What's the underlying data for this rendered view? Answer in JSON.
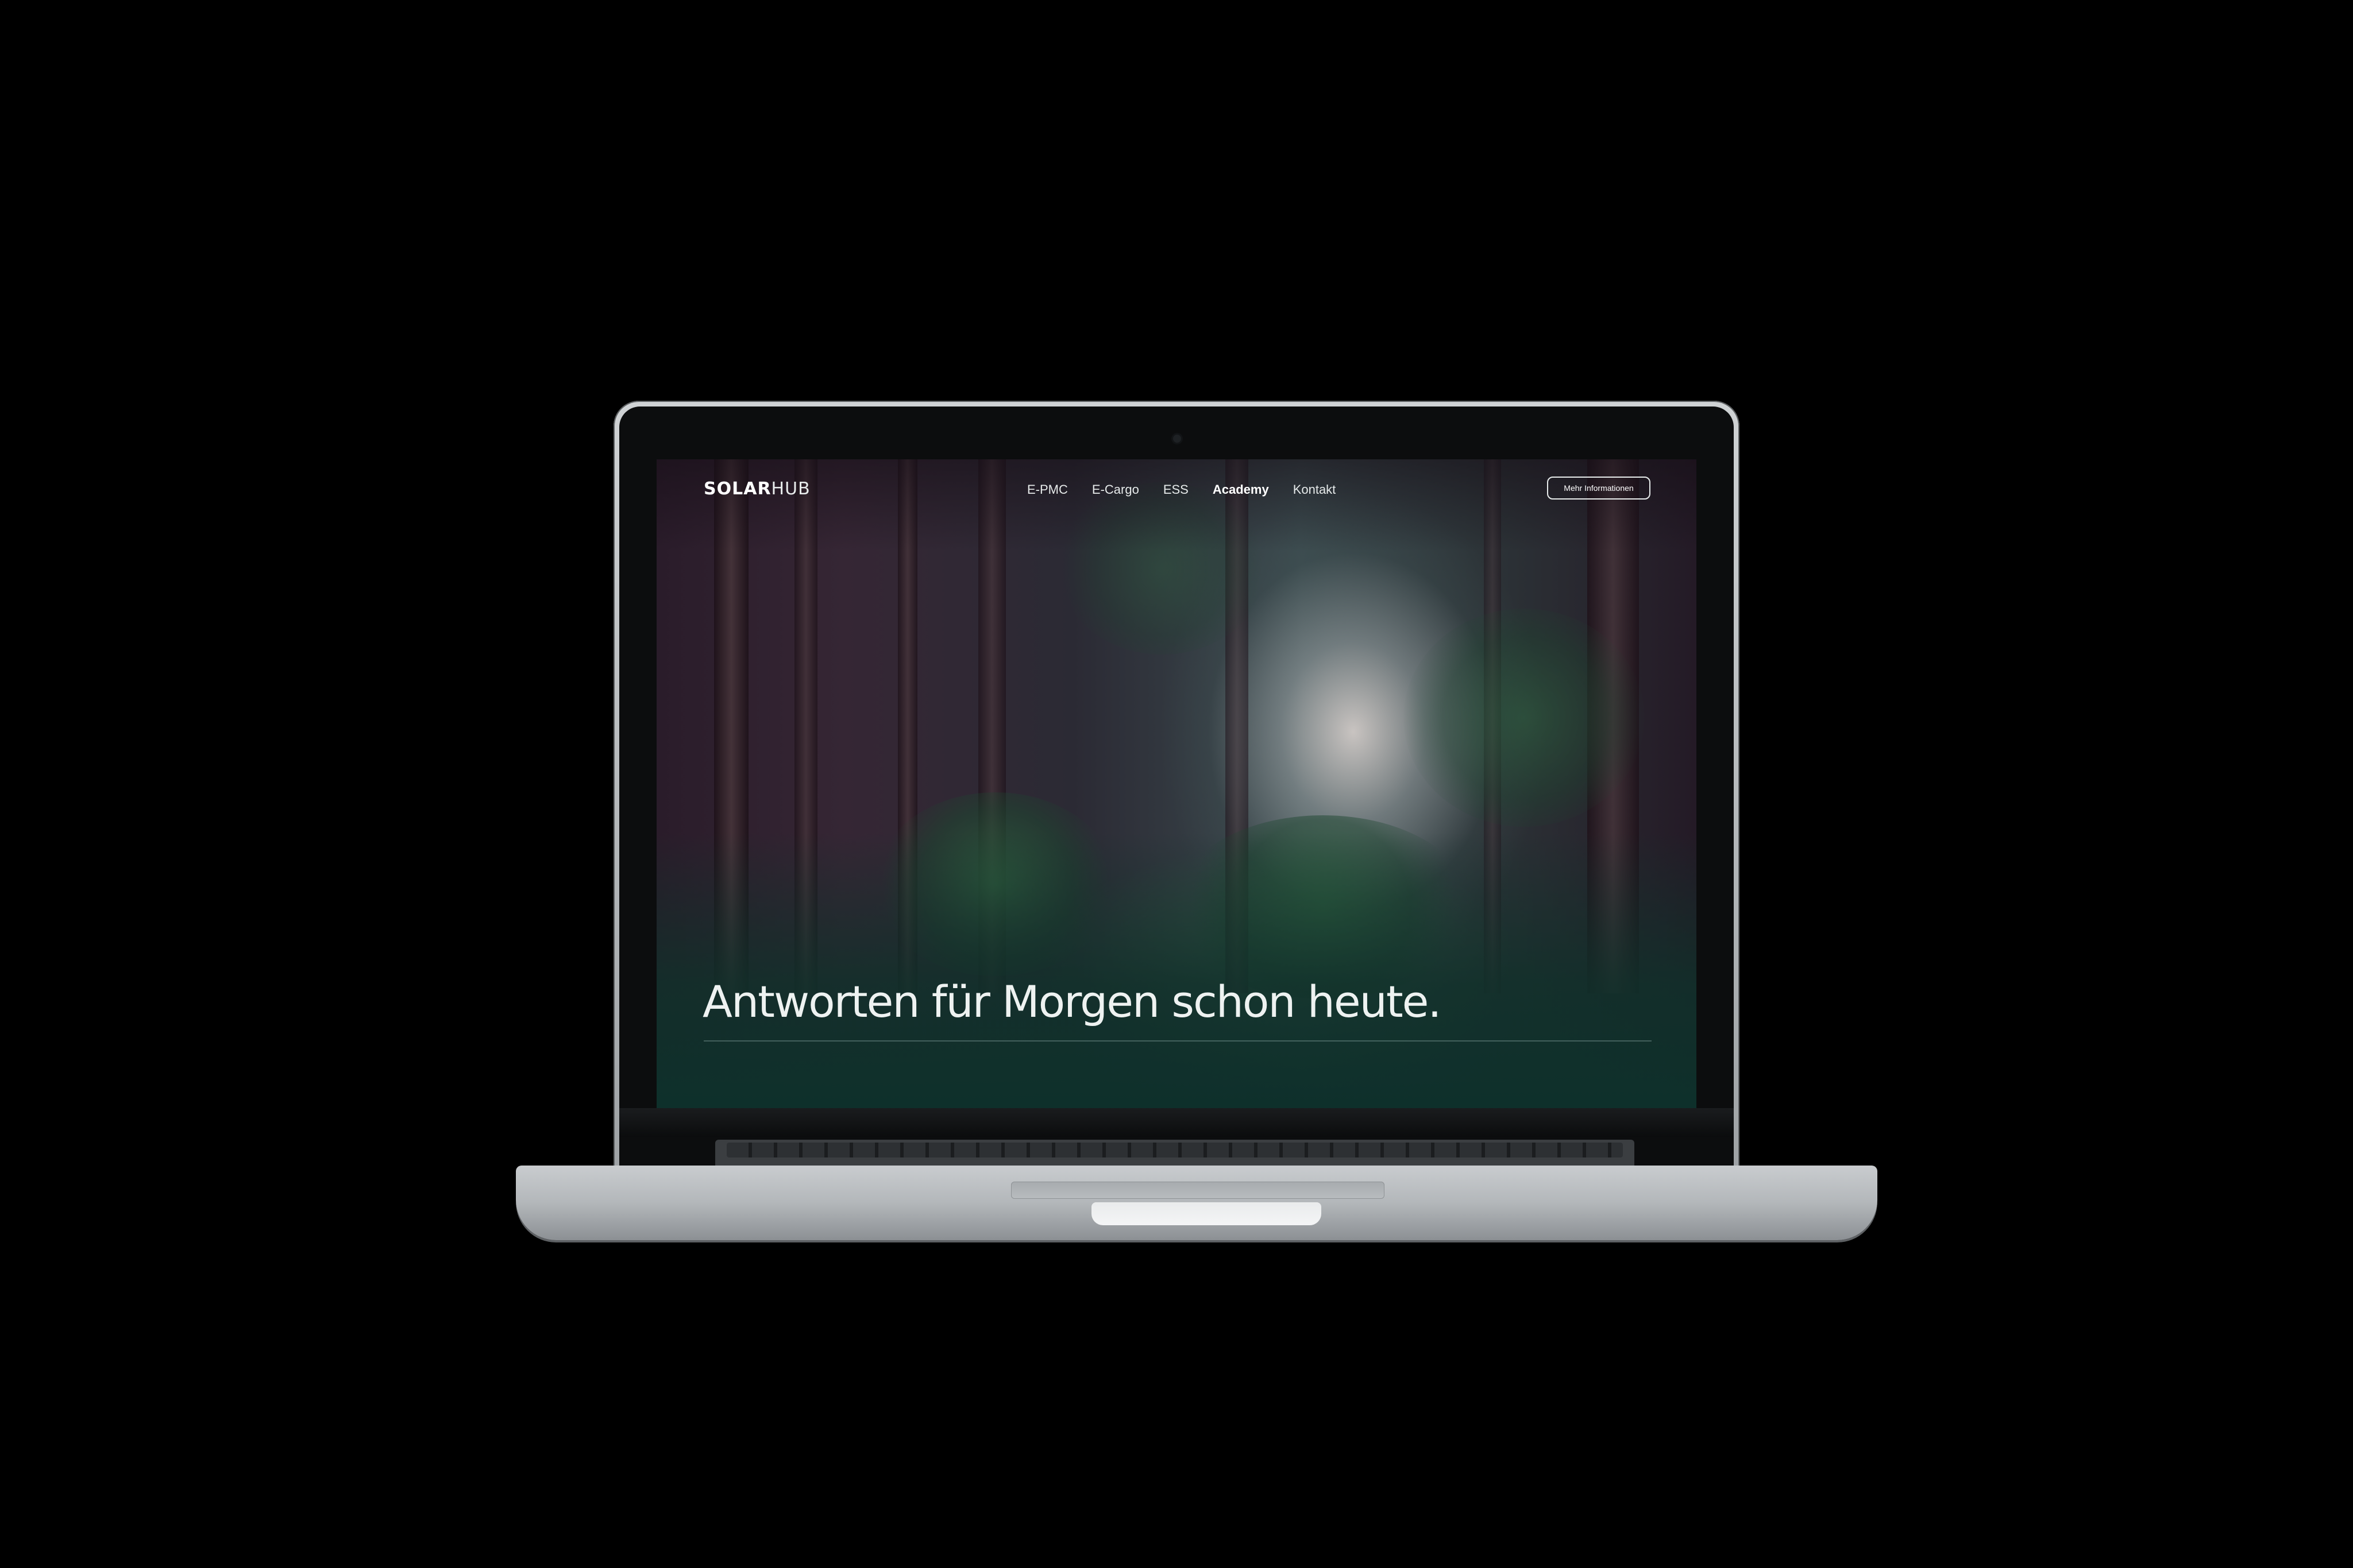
{
  "site": {
    "logo": {
      "bold": "SOLAR",
      "light": "HUB"
    },
    "nav": [
      {
        "label": "E-PMC",
        "active": false
      },
      {
        "label": "E-Cargo",
        "active": false
      },
      {
        "label": "ESS",
        "active": false
      },
      {
        "label": "Academy",
        "active": true
      },
      {
        "label": "Kontakt",
        "active": false
      }
    ],
    "cta_label": "Mehr Informationen"
  },
  "hero": {
    "title": "Antworten für Morgen schon heute."
  },
  "colors": {
    "accent": "#0e302b",
    "text": "#ffffff",
    "background": "#000000"
  },
  "icons": {
    "camera": "webcam-dot"
  }
}
